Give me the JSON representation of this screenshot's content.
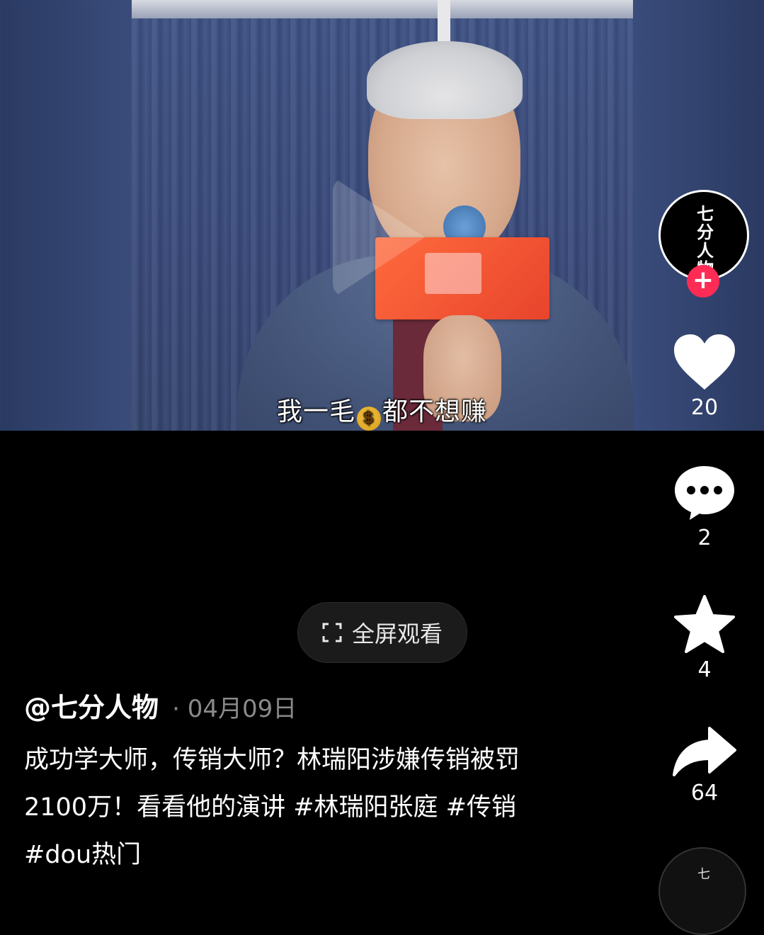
{
  "video": {
    "subtitle_before": "我一毛",
    "subtitle_emoji": "$",
    "subtitle_after": "都不想赚"
  },
  "creator": {
    "avatar_text": "七分人物",
    "follow_symbol": "+"
  },
  "actions": {
    "likes": "20",
    "comments": "2",
    "favorites": "4",
    "shares": "64"
  },
  "fullscreen": {
    "label": "全屏观看"
  },
  "post": {
    "author": "@七分人物",
    "date": "· 04月09日",
    "caption": "成功学大师，传销大师？林瑞阳涉嫌传销被罚2100万！看看他的演讲 #林瑞阳张庭 #传销#dou热门"
  },
  "colors": {
    "accent": "#fe2c55",
    "background": "#000000"
  }
}
